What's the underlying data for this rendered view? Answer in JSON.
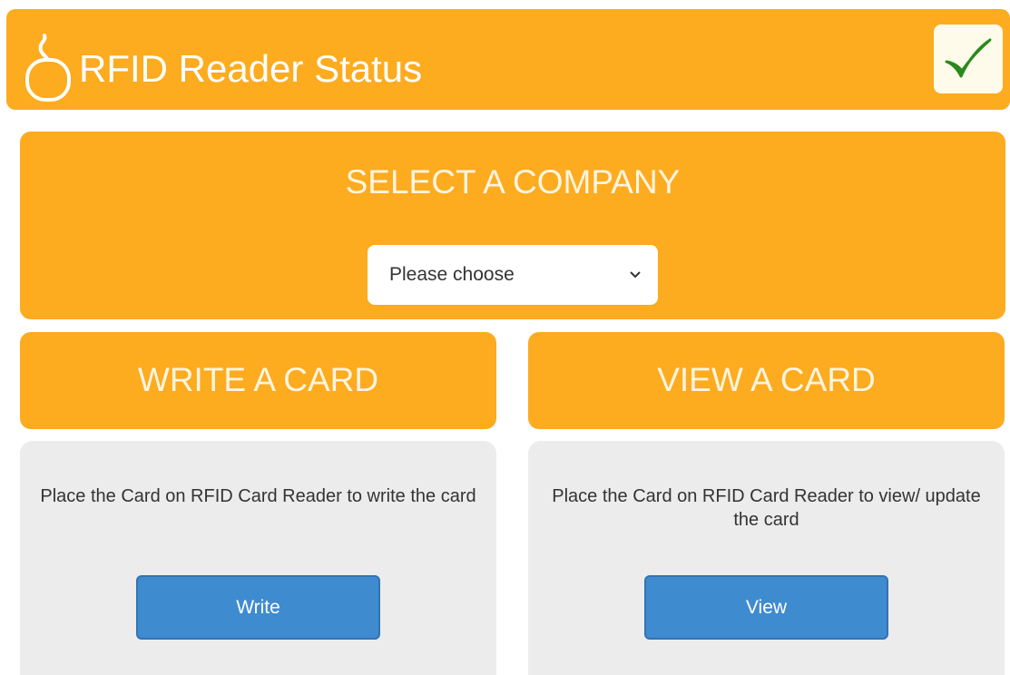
{
  "header": {
    "title": "RFID Reader Status",
    "icon": "mouse-icon",
    "status_icon": "check-icon",
    "color": "#fdab1f"
  },
  "company": {
    "title": "SELECT A COMPANY",
    "select_value": "Please choose"
  },
  "write": {
    "title": "WRITE A CARD",
    "description": "Place the Card on RFID Card Reader to write the card",
    "button_label": "Write"
  },
  "view": {
    "title": "VIEW A CARD",
    "description": "Place the Card on RFID Card Reader to view/ update the card",
    "button_label": "View"
  },
  "colors": {
    "accent": "#fdab1f",
    "button": "#3f8bd0",
    "check": "#2a8a1c",
    "card_bg": "#ececec"
  }
}
